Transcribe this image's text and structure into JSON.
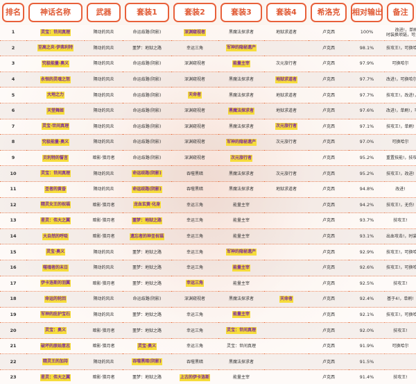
{
  "columns": [
    "排名",
    "神话名称",
    "武器",
    "套装1",
    "套装2",
    "套装3",
    "套装4",
    "希洛克",
    "相对输出",
    "备注"
  ],
  "rows": [
    {
      "rank": "1",
      "myth": "灵宝：世间真理",
      "weapon": "隔动的风炎",
      "set1": "命运歧路(阴影)",
      "set2": "深渊窥视者",
      "set3": "黑魔法探求者",
      "set4": "地狱求道者",
      "siroc": "卢克西",
      "output": "100%",
      "note": "改进!，单刷!\n时装换项链，可换哈尔",
      "hl": [
        "myth",
        "set2"
      ]
    },
    {
      "rank": "2",
      "myth": "至高之炎·伊弗利特",
      "weapon": "隔动的风炎",
      "set1": "噩梦：地狱之路",
      "set2": "幸运三角",
      "set3": "军神的隐秘遗产",
      "set4": "",
      "siroc": "卢克西",
      "output": "98.1%",
      "note": "技攻王!，可换哈尔",
      "hl": [
        "myth",
        "set3"
      ]
    },
    {
      "rank": "3",
      "myth": "究极能量·奥义",
      "weapon": "隔动的风炎",
      "set1": "命运歧路(阴影)",
      "set2": "深渊窥视者",
      "set3": "能量主宰",
      "set4": "次元旅行者",
      "siroc": "卢克西",
      "output": "97.9%",
      "note": "可换哈尔",
      "hl": [
        "myth",
        "set3"
      ]
    },
    {
      "rank": "4",
      "myth": "永恒的灵魂之怒",
      "weapon": "隔动的风炎",
      "set1": "命运歧路(阴影)",
      "set2": "深渊窥视者",
      "set3": "黑魔法探求者",
      "set4": "地狱求道者",
      "siroc": "卢克西",
      "output": "97.7%",
      "note": "改进!，可换哈尔",
      "hl": [
        "myth",
        "set4"
      ]
    },
    {
      "rank": "5",
      "myth": "大地之力",
      "weapon": "隔动的风炎",
      "set1": "命运歧路(阴影)",
      "set2": "天命者",
      "set3": "黑魔法探求者",
      "set4": "地狱求道者",
      "siroc": "卢克西",
      "output": "97.7%",
      "note": "技攻王!，改进!，单刷!",
      "hl": [
        "myth",
        "set2"
      ]
    },
    {
      "rank": "6",
      "myth": "天堂舞姬",
      "weapon": "隔动的风炎",
      "set1": "命运歧路(阴影)",
      "set2": "深渊窥视者",
      "set3": "黑魔法探求者",
      "set4": "地狱求道者",
      "siroc": "卢克西",
      "output": "97.6%",
      "note": "改进!，单刷!，可换哈尔",
      "hl": [
        "myth",
        "set3"
      ]
    },
    {
      "rank": "7",
      "myth": "灵宝·世间真理",
      "weapon": "隔动的风炎",
      "set1": "命运歧路(阴影)",
      "set2": "深渊窥视者",
      "set3": "黑魔法探求者",
      "set4": "次元旅行者",
      "siroc": "卢克西",
      "output": "97.1%",
      "note": "技攻王!，单刷!",
      "hl": [
        "myth",
        "set4"
      ]
    },
    {
      "rank": "8",
      "myth": "究极能量·奥义",
      "weapon": "隔动的风炎",
      "set1": "命运歧路(阴影)",
      "set2": "深渊窥视者",
      "set3": "军神的隐秘遗产",
      "set4": "次元旅行者",
      "siroc": "卢克西",
      "output": "97.0%",
      "note": "可换哈尔",
      "hl": [
        "myth",
        "set3"
      ]
    },
    {
      "rank": "9",
      "myth": "贝利特的誓言",
      "weapon": "暗影·猎月者",
      "set1": "命运歧路(阴影)",
      "set2": "深渊窥视者",
      "set3": "次元旅行者",
      "set4": "",
      "siroc": "卢克西",
      "output": "95.2%",
      "note": "重置技能!，技攻王!，单刷!",
      "hl": [
        "myth",
        "set3"
      ]
    },
    {
      "rank": "10",
      "myth": "灵宝：世间真理",
      "weapon": "隔动的风炎",
      "set1": "命运歧路(阴影)",
      "set2": "吞噬黑暗",
      "set3": "黑魔法探求者",
      "set4": "次元旅行者",
      "siroc": "卢克西",
      "output": "95.2%",
      "note": "技攻王!，改进!",
      "hl": [
        "myth",
        "set1"
      ]
    },
    {
      "rank": "11",
      "myth": "圣者的黄昏",
      "weapon": "隔动的风炎",
      "set1": "命运歧路(阴影)",
      "set2": "吞噬黑暗",
      "set3": "黑魔法探求者",
      "set4": "地狱求道者",
      "siroc": "卢克西",
      "output": "94.8%",
      "note": "改进!",
      "hl": [
        "myth",
        "set1"
      ]
    },
    {
      "rank": "12",
      "myth": "精灵女王的祝福",
      "weapon": "暗影·猎月者",
      "set1": "龙血玄黄·化身",
      "set2": "幸运三角",
      "set3": "能量主宰",
      "set4": "",
      "siroc": "卢克西",
      "output": "94.2%",
      "note": "技攻王!，无伤!",
      "hl": [
        "myth",
        "set1"
      ]
    },
    {
      "rank": "13",
      "myth": "星灵：伟大之翼",
      "weapon": "暗影·猎月者",
      "set1": "噩梦：地狱之路",
      "set2": "幸运三角",
      "set3": "能量主宰",
      "set4": "",
      "siroc": "卢克西",
      "output": "93.7%",
      "note": "技攻王!",
      "hl": [
        "myth",
        "set1"
      ]
    },
    {
      "rank": "14",
      "myth": "大自然的呼吸",
      "weapon": "暗影·猎月者",
      "set1": "遗忘者的神圣祝福",
      "set2": "幸运三角",
      "set3": "能量主宰",
      "set4": "",
      "siroc": "卢克西",
      "output": "93.1%",
      "note": "出血攻击!，时装换项链",
      "hl": [
        "myth",
        "set1"
      ]
    },
    {
      "rank": "15",
      "myth": "灵宝·奥义",
      "weapon": "隔动的风炎",
      "set1": "噩梦：地狱之路",
      "set2": "幸运三角",
      "set3": "军神的隐秘遗产",
      "set4": "",
      "siroc": "卢克西",
      "output": "92.9%",
      "note": "技攻王!，可换哈尔",
      "hl": [
        "myth",
        "set3"
      ]
    },
    {
      "rank": "16",
      "myth": "噬魂者的末日",
      "weapon": "隔动的风炎",
      "set1": "噩梦：地狱之路",
      "set2": "幸运三角",
      "set3": "能量主宰",
      "set4": "",
      "siroc": "卢克西",
      "output": "92.6%",
      "note": "技攻王!，可换哈尔",
      "hl": [
        "myth",
        "set3"
      ]
    },
    {
      "rank": "17",
      "myth": "伊卡洛斯的羽翼",
      "weapon": "暗影·猎月者",
      "set1": "噩梦：地狱之路",
      "set2": "幸运三角",
      "set3": "能量主宰",
      "set4": "",
      "siroc": "卢克西",
      "output": "92.5%",
      "note": "技攻王!",
      "hl": [
        "myth",
        "set2"
      ]
    },
    {
      "rank": "18",
      "myth": "命运的轮回",
      "weapon": "隔动的风炎",
      "set1": "命运歧路(阴影)",
      "set2": "深渊窥视者",
      "set3": "黑魔法探求者",
      "set4": "天命者",
      "siroc": "卢克西",
      "output": "92.4%",
      "note": "基于4!，单刷!",
      "hl": [
        "myth",
        "set4"
      ]
    },
    {
      "rank": "19",
      "myth": "军神的庇护宝石",
      "weapon": "隔动的风炎",
      "set1": "噩梦：地狱之路",
      "set2": "幸运三角",
      "set3": "能量主宰",
      "set4": "",
      "siroc": "卢克西",
      "output": "92.1%",
      "note": "技攻王!，可换哈尔",
      "hl": [
        "myth",
        "set3"
      ]
    },
    {
      "rank": "20",
      "myth": "灵宝：奥义",
      "weapon": "暗影·猎月者",
      "set1": "噩梦：地狱之路",
      "set2": "幸运三角",
      "set3": "灵宝：世间真理",
      "set4": "",
      "siroc": "卢克西",
      "output": "92.0%",
      "note": "技攻王!",
      "hl": [
        "myth",
        "set3"
      ]
    },
    {
      "rank": "21",
      "myth": "破坏的原始意志",
      "weapon": "暗影·猎月者",
      "set1": "灵宝·奥义",
      "set2": "幸运三角",
      "set3": "灵宝：世间真理",
      "set4": "",
      "siroc": "卢克西",
      "output": "91.9%",
      "note": "可换哈尔",
      "hl": [
        "myth",
        "set1"
      ]
    },
    {
      "rank": "22",
      "myth": "精灵王的加持",
      "weapon": "隔动的风炎",
      "set1": "吞噬黑暗(阴影)",
      "set2": "吞噬黑暗",
      "set3": "黑魔法探求者",
      "set4": "",
      "siroc": "卢克西",
      "output": "91.5%",
      "note": "",
      "hl": [
        "myth",
        "set1"
      ]
    },
    {
      "rank": "23",
      "myth": "星灵：伟大之翼",
      "weapon": "暗影·猎月者",
      "set1": "噩梦：地狱之路",
      "set2": "上古的伊卡洛斯",
      "set3": "能量主宰",
      "set4": "",
      "siroc": "卢克西",
      "output": "91.4%",
      "note": "技攻王!",
      "hl": [
        "myth",
        "set2"
      ]
    }
  ]
}
